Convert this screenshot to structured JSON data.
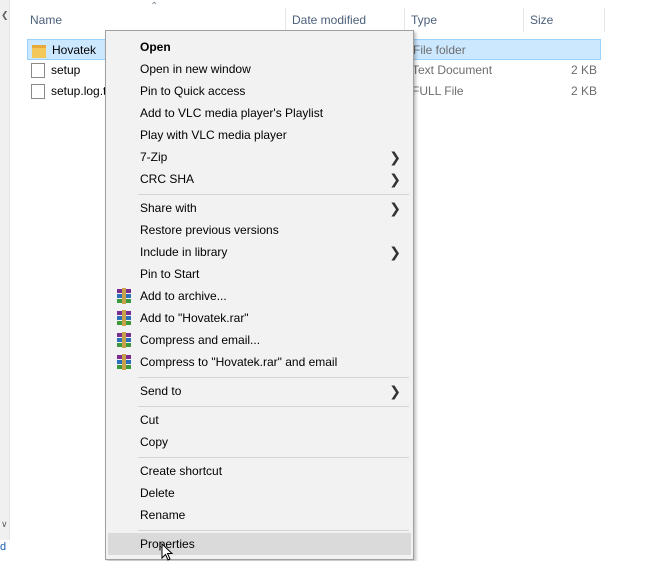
{
  "header": {
    "name": "Name",
    "date_modified": "Date modified",
    "type": "Type",
    "size": "Size"
  },
  "files": [
    {
      "name": "Hovatek",
      "type": "File folder",
      "size": "",
      "icon": "folder-icon"
    },
    {
      "name": "setup",
      "type": "Text Document",
      "size": "2 KB",
      "icon": "text-document-icon"
    },
    {
      "name": "setup.log.t",
      "type": "FULL File",
      "size": "2 KB",
      "icon": "file-icon"
    }
  ],
  "menu": {
    "open": "Open",
    "open_new_window": "Open in new window",
    "pin_quick_access": "Pin to Quick access",
    "add_vlc_playlist": "Add to VLC media player's Playlist",
    "play_vlc": "Play with VLC media player",
    "seven_zip": "7-Zip",
    "crc_sha": "CRC SHA",
    "share_with": "Share with",
    "restore_versions": "Restore previous versions",
    "include_library": "Include in library",
    "pin_start": "Pin to Start",
    "add_archive": "Add to archive...",
    "add_rar": "Add to \"Hovatek.rar\"",
    "compress_email": "Compress and email...",
    "compress_rar_email": "Compress to \"Hovatek.rar\" and email",
    "send_to": "Send to",
    "cut": "Cut",
    "copy": "Copy",
    "create_shortcut": "Create shortcut",
    "delete": "Delete",
    "rename": "Rename",
    "properties": "Properties"
  },
  "left_tail": "d",
  "colors": {
    "selection": "#cce8ff",
    "menu_bg": "#f2f2f2",
    "hover": "#dadada"
  }
}
